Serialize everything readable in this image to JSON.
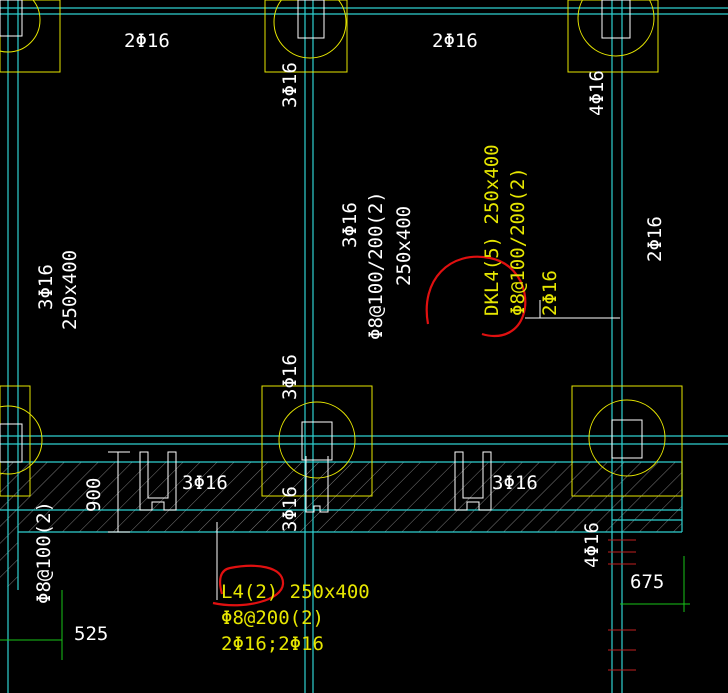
{
  "labels": {
    "top_left_2phi16": "2Φ16",
    "top_mid_2phi16": "2Φ16",
    "right_top_4phi16": "4Φ16",
    "col_mid_top_3phi16": "3Φ16",
    "left_3phi16": "3Φ16",
    "left_size": "250x400",
    "mid_3phi16": "3Φ16",
    "mid_stirrup": "Φ8@100/200(2)",
    "mid_size": "250x400",
    "dkl_name": "DKL4(5) 250x400",
    "dkl_stirrup": "Φ8@100/200(2)",
    "dkl_bars": "2Φ16",
    "right_2phi16": "2Φ16",
    "mid_col_3phi16": "3Φ16",
    "wall_left_3phi16": "3Φ16",
    "wall_right_3phi16": "3Φ16",
    "under_3phi16": "3Φ16",
    "dim_900": "900",
    "left_stirrup": "Φ8@100(2)",
    "dim_525": "525",
    "right_4phi16": "4Φ16",
    "dim_675": "675",
    "l4_name": "L4(2) 250x400",
    "l4_stirrup": "Φ8@200(2)",
    "l4_bars": "2Φ16;2Φ16"
  },
  "colors": {
    "background": "#000000",
    "axis_cyan": "#2fd0d0",
    "column_yellow": "#e6e600",
    "text_white": "#ffffff",
    "markup_red": "#e01010",
    "dim_green": "#19c319"
  }
}
